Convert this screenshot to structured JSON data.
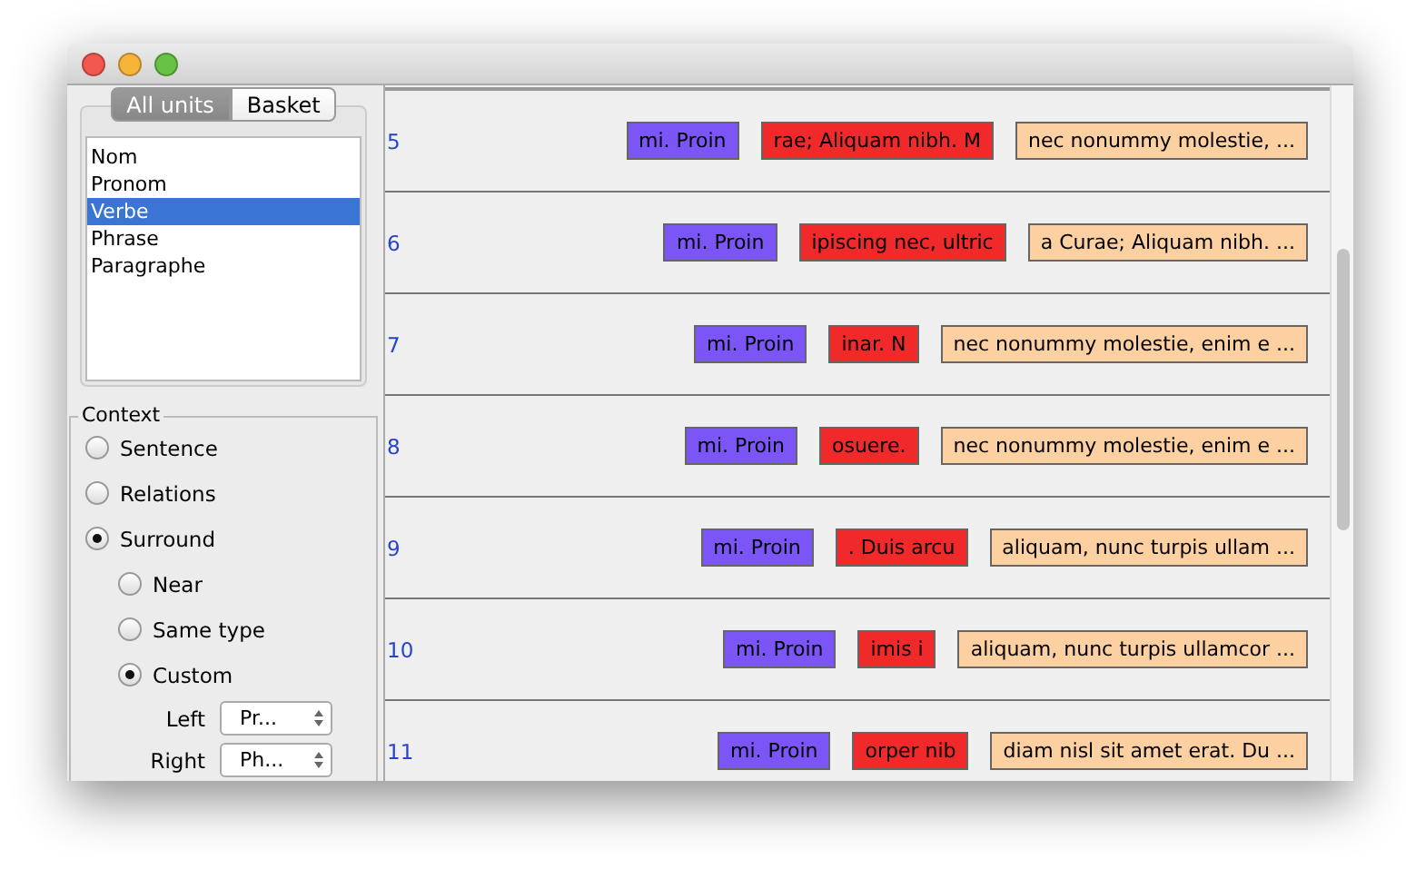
{
  "tabs": [
    {
      "label": "All units",
      "selected": true
    },
    {
      "label": "Basket",
      "selected": false
    }
  ],
  "units": [
    {
      "label": "Nom",
      "selected": false
    },
    {
      "label": "Pronom",
      "selected": false
    },
    {
      "label": "Verbe",
      "selected": true
    },
    {
      "label": "Phrase",
      "selected": false
    },
    {
      "label": "Paragraphe",
      "selected": false
    }
  ],
  "context": {
    "title": "Context",
    "options": [
      {
        "label": "Sentence",
        "selected": false
      },
      {
        "label": "Relations",
        "selected": false
      },
      {
        "label": "Surround",
        "selected": true,
        "children": [
          {
            "label": "Near",
            "selected": false
          },
          {
            "label": "Same type",
            "selected": false
          },
          {
            "label": "Custom",
            "selected": true
          }
        ]
      }
    ],
    "selectors": [
      {
        "label": "Left",
        "value": "Pr..."
      },
      {
        "label": "Right",
        "value": "Ph..."
      }
    ]
  },
  "rows": [
    {
      "number": "5",
      "tokens": [
        {
          "text": "mi. Proin",
          "color": "#7b55f5"
        },
        {
          "text": "rae; Aliquam nibh. M",
          "color": "#f02a2a"
        },
        {
          "text": "nec nonummy molestie, ...",
          "color": "#fdd0a2"
        }
      ]
    },
    {
      "number": "6",
      "tokens": [
        {
          "text": "mi. Proin",
          "color": "#7b55f5"
        },
        {
          "text": "ipiscing nec, ultric",
          "color": "#f02a2a"
        },
        {
          "text": "a Curae; Aliquam nibh.  ...",
          "color": "#fdd0a2"
        }
      ]
    },
    {
      "number": "7",
      "tokens": [
        {
          "text": "mi. Proin",
          "color": "#7b55f5"
        },
        {
          "text": "inar. N",
          "color": "#f02a2a"
        },
        {
          "text": "nec nonummy molestie, enim e ...",
          "color": "#fdd0a2"
        }
      ]
    },
    {
      "number": "8",
      "tokens": [
        {
          "text": "mi. Proin",
          "color": "#7b55f5"
        },
        {
          "text": "osuere.",
          "color": "#f02a2a"
        },
        {
          "text": "nec nonummy molestie, enim e ...",
          "color": "#fdd0a2"
        }
      ]
    },
    {
      "number": "9",
      "tokens": [
        {
          "text": "mi. Proin",
          "color": "#7b55f5"
        },
        {
          "text": ". Duis arcu",
          "color": "#f02a2a"
        },
        {
          "text": "aliquam, nunc turpis ullam ...",
          "color": "#fdd0a2"
        }
      ]
    },
    {
      "number": "10",
      "tokens": [
        {
          "text": "mi. Proin",
          "color": "#7b55f5"
        },
        {
          "text": "imis i",
          "color": "#f02a2a"
        },
        {
          "text": "aliquam, nunc turpis ullamcor ...",
          "color": "#fdd0a2"
        }
      ]
    },
    {
      "number": "11",
      "tokens": [
        {
          "text": "mi. Proin",
          "color": "#7b55f5"
        },
        {
          "text": "orper nib",
          "color": "#f02a2a"
        },
        {
          "text": "diam nisl sit amet erat. Du ...",
          "color": "#fdd0a2"
        }
      ]
    }
  ]
}
